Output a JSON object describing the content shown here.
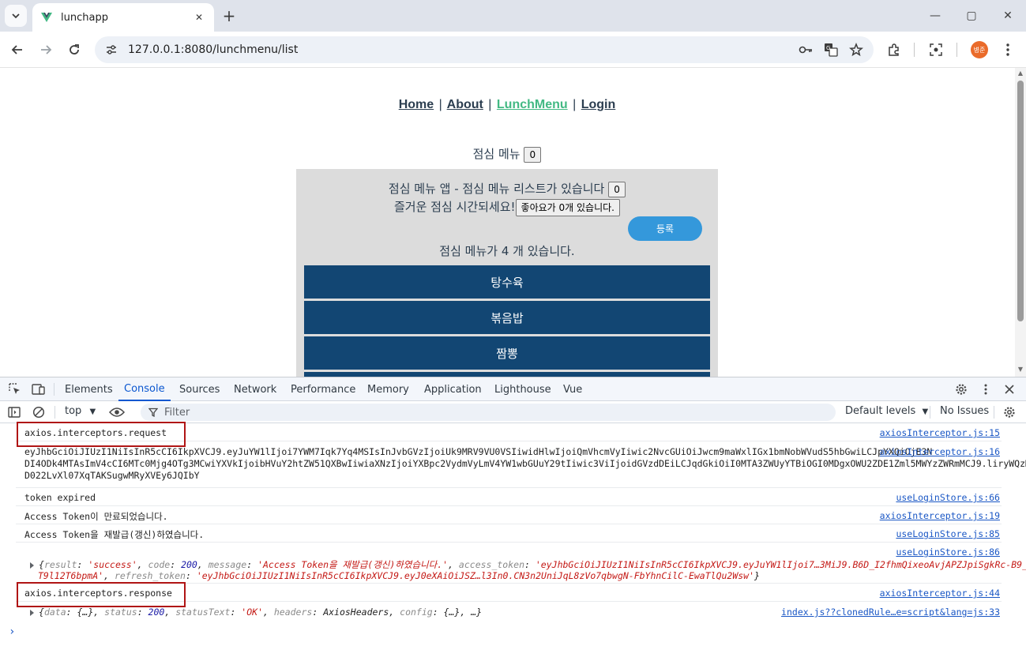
{
  "browser": {
    "tab_title": "lunchapp",
    "url": "127.0.0.1:8080/lunchmenu/list",
    "avatar_text": "병준"
  },
  "page": {
    "nav": [
      "Home",
      "About",
      "LunchMenu",
      "Login"
    ],
    "nav_separator": "|",
    "heading": "점심 메뉴",
    "heading_count": "0",
    "panel_line1": "점심 메뉴 앱 - 점심 메뉴 리스트가 있습니다",
    "panel_line1_count": "0",
    "panel_line2": "즐거운 점심 시간되세요!",
    "like_button": "좋아요가 0개 있습니다.",
    "register_button": "등록",
    "count_text": "점심 메뉴가 4 개 있습니다.",
    "menu_items": [
      "탕수육",
      "볶음밥",
      "짬뽕"
    ]
  },
  "devtools": {
    "tabs": [
      "Elements",
      "Console",
      "Sources",
      "Network",
      "Performance",
      "Memory",
      "Application",
      "Lighthouse",
      "Vue"
    ],
    "active_tab": "Console",
    "context": "top",
    "filter_placeholder": "Filter",
    "levels": "Default levels",
    "issues": "No Issues",
    "logs": [
      {
        "msg": "axios.interceptors.request",
        "src": "axiosInterceptor.js:15"
      },
      {
        "msg": "eyJhbGciOiJIUzI1NiIsInR5cCI6IkpXVCJ9.eyJuYW1lIjoi7YWM7Iqk7Yq4MSIsInJvbGVzIjoiUk9MRV9VU0VSIiwidHlwIjoiQmVhcmVyIiwic2NvcGUiOiJwcm9maWxlIGx1bmNobWVudS5hbGwiLCJpYXQiOjE3N",
        "msg2": "DI4ODk4MTAsImV4cCI6MTc0Mjg4OTg3MCwiYXVkIjoibHVuY2htZW51QXBwIiwiaXNzIjoiYXBpc2VydmVyLmV4YW1wbGUuY29tIiwic3ViIjoidGVzdDEiLCJqdGkiOiI0MTA3ZWUyYTBiOGI0MDgxOWU2ZDE1Zml5MWYzZWRmMCJ9.liryWQzMJ9-",
        "msg3": "D022LvXl07XqTAKSugwMRyXVEy6JQIbY",
        "src": "axiosInterceptor.js:16"
      },
      {
        "msg": "token expired",
        "src": "useLoginStore.js:66"
      },
      {
        "msg": "Access Token이 만료되었습니다.",
        "src": "axiosInterceptor.js:19"
      },
      {
        "msg": "Access Token을 재발급(갱신)하였습니다.",
        "src": "useLoginStore.js:85"
      },
      {
        "src": "useLoginStore.js:86"
      },
      {
        "msg": "axios.interceptors.response",
        "src": "axiosInterceptor.js:44"
      },
      {
        "src": "index.js??clonedRule…e=script&lang=js:33"
      }
    ],
    "obj1": {
      "k1": "result",
      "v1": "'success'",
      "k2": "code",
      "v2": "200",
      "k3": "message",
      "v3": "'Access Token을 재발급(갱신)하였습니다.'",
      "k4": "access_token",
      "v4": "'eyJhbGciOiJIUzI1NiIsInR5cCI6IkpXVCJ9.eyJuYW1lIjoi7…3MiJ9.B6D_I2fhmQixeoAvjAPZJpiSgkRc-B9_",
      "line2a": "T9l12T6bpmA'",
      "k5": "refresh_token",
      "v5": "'eyJhbGciOiJIUzI1NiIsInR5cCI6IkpXVCJ9.eyJ0eXAiOiJSZ…l3In0.CN3n2UniJqL8zVo7qbwgN-FbYhnCilC-EwaTlQu2Wsw'"
    },
    "obj2": {
      "k1": "data",
      "v1": "{…}",
      "k2": "status",
      "v2": "200",
      "k3": "statusText",
      "v3": "'OK'",
      "k4": "headers",
      "v4": "AxiosHeaders",
      "k5": "config",
      "v5": "{…}",
      "tail": "…"
    },
    "prompt": "›"
  }
}
